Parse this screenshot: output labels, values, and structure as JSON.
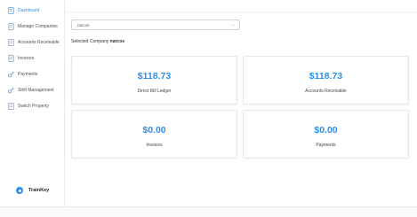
{
  "sidebar": {
    "items": [
      {
        "label": "Dashboard",
        "icon": "document-icon",
        "active": true
      },
      {
        "label": "Manage Companies",
        "icon": "document-icon",
        "active": false
      },
      {
        "label": "Accounts Receivable",
        "icon": "document-icon",
        "active": false
      },
      {
        "label": "Invoices",
        "icon": "document-icon",
        "active": false
      },
      {
        "label": "Payments",
        "icon": "key-icon",
        "active": false
      },
      {
        "label": "Shift Management",
        "icon": "key-icon",
        "active": false
      },
      {
        "label": "Switch Property",
        "icon": "document-icon",
        "active": false
      }
    ],
    "brand": "TrainKey"
  },
  "company_select": {
    "value": "narcos"
  },
  "selected_company": {
    "prefix": "Selected Company",
    "name": "narcos"
  },
  "cards": [
    {
      "value": "$118.73",
      "label": "Direct Bill Ledger"
    },
    {
      "value": "$118.73",
      "label": "Accounts Receivable"
    },
    {
      "value": "$0.00",
      "label": "Invoices"
    },
    {
      "value": "$0.00",
      "label": "Payments"
    }
  ],
  "colors": {
    "accent": "#2f8fe8",
    "active_nav": "#3a8ee6"
  }
}
